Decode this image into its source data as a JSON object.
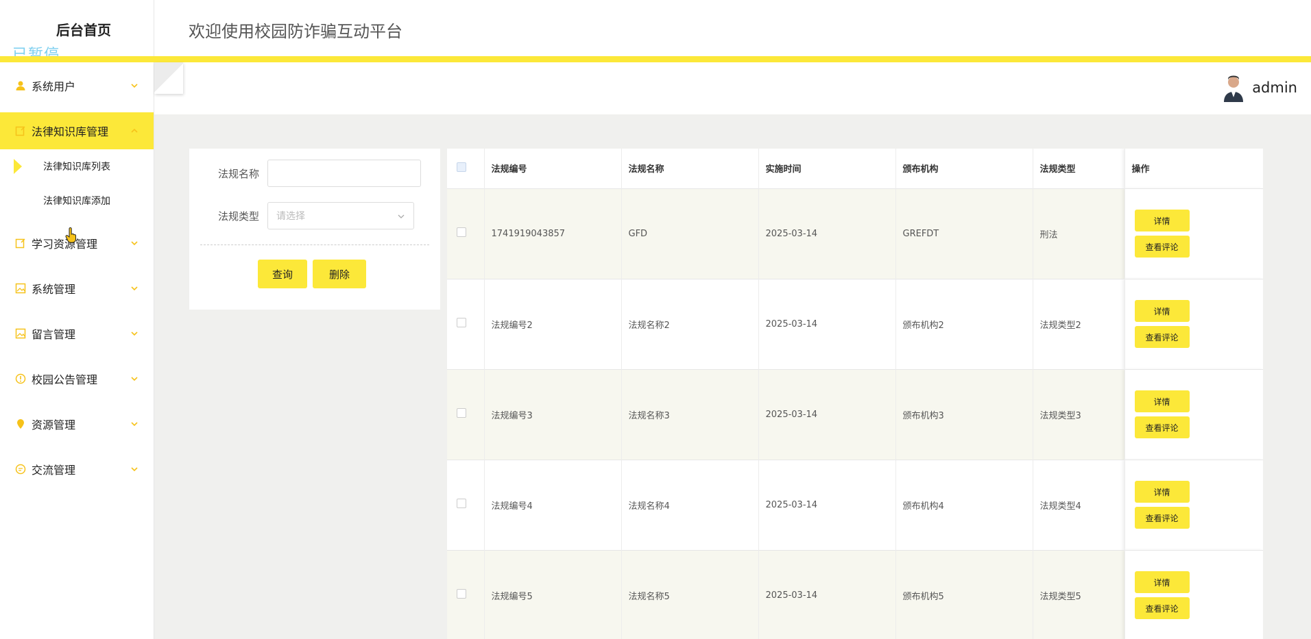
{
  "sidebar": {
    "brand": "后台首页",
    "paused_overlay": "已暂停",
    "menu": [
      {
        "label": "系统用户"
      },
      {
        "label": "法律知识库管理"
      },
      {
        "label": "学习资源管理"
      },
      {
        "label": "系统管理"
      },
      {
        "label": "留言管理"
      },
      {
        "label": "校园公告管理"
      },
      {
        "label": "资源管理"
      },
      {
        "label": "交流管理"
      }
    ],
    "submenu": [
      {
        "label": "法律知识库列表"
      },
      {
        "label": "法律知识库添加"
      }
    ],
    "accent_color": "#fce839"
  },
  "header": {
    "title": "欢迎使用校园防诈骗互动平台",
    "username": "admin"
  },
  "search": {
    "name_label": "法规名称",
    "name_value": "",
    "type_label": "法规类型",
    "type_placeholder": "请选择",
    "query_button": "查询",
    "delete_button": "删除"
  },
  "table": {
    "columns": [
      "法规编号",
      "法规名称",
      "实施时间",
      "颁布机构",
      "法规类型",
      "操作"
    ],
    "rows": [
      {
        "code": "1741919043857",
        "name": "GFD",
        "date": "2025-03-14",
        "org": "GREFDT",
        "type": "刑法"
      },
      {
        "code": "法规编号2",
        "name": "法规名称2",
        "date": "2025-03-14",
        "org": "颁布机构2",
        "type": "法规类型2"
      },
      {
        "code": "法规编号3",
        "name": "法规名称3",
        "date": "2025-03-14",
        "org": "颁布机构3",
        "type": "法规类型3"
      },
      {
        "code": "法规编号4",
        "name": "法规名称4",
        "date": "2025-03-14",
        "org": "颁布机构4",
        "type": "法规类型4"
      },
      {
        "code": "法规编号5",
        "name": "法规名称5",
        "date": "2025-03-14",
        "org": "颁布机构5",
        "type": "法规类型5"
      }
    ],
    "detail_label": "详情",
    "comment_label": "查看评论"
  }
}
